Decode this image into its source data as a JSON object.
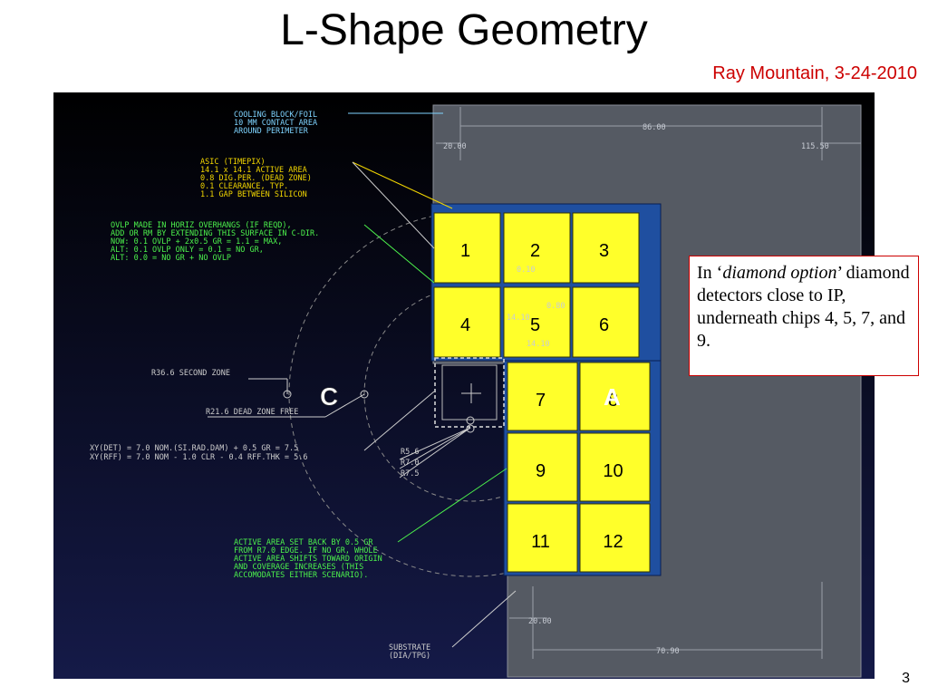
{
  "slide": {
    "title": "L-Shape Geometry",
    "subtitle": "Ray Mountain, 3-24-2010",
    "page_number": "3"
  },
  "callout": {
    "prefix": "In ‘",
    "emphasis": "diamond option",
    "suffix": "’ diamond detectors close to IP, underneath chips 4, 5, 7, and 9."
  },
  "chips": [
    "1",
    "2",
    "3",
    "4",
    "5",
    "6",
    "7",
    "8",
    "9",
    "10",
    "11",
    "12"
  ],
  "annotations": {
    "cooling": [
      "COOLING BLOCK/FOIL",
      "10 MM CONTACT AREA",
      "AROUND PERIMETER"
    ],
    "asic": [
      "ASIC (TIMEPIX)",
      "14.1 x 14.1 ACTIVE AREA",
      "0.8 DIG.PER. (DEAD ZONE)",
      "0.1 CLEARANCE, TYP.",
      "1.1 GAP BETWEEN SILICON"
    ],
    "ovlp": [
      "OVLP MADE IN HORIZ OVERHANGS (IF REQD),",
      "ADD OR RM BY EXTENDING THIS SURFACE IN C-DIR.",
      "NOW: 0.1 OVLP + 2x0.5 GR = 1.1 = MAX,",
      "ALT: 0.1 OVLP ONLY = 0.1 = NO GR,",
      "ALT: 0.0 = NO GR + NO OVLP"
    ],
    "second_zone": "R36.6 SECOND ZONE",
    "dead_zone": "R21.6 DEAD ZONE FREE",
    "xy": [
      "XY(DET) = 7.0 NOM.(SI.RAD.DAM) + 0.5 GR    = 7.5",
      "XY(RFF) = 7.0 NOM - 1.0 CLR - 0.4 RFF.THK = 5.6"
    ],
    "radii": [
      "R5.6",
      "R7.0",
      "R7.5"
    ],
    "active_area": [
      "ACTIVE AREA SET BACK BY 0.5 GR",
      "FROM R7.0 EDGE.  IF NO GR, WHOLE",
      "ACTIVE AREA SHIFTS TOWARD ORIGIN",
      "AND COVERAGE INCREASES (THIS",
      "ACCOMODATES EITHER SCENARIO)."
    ],
    "substrate": [
      "SUBSTRATE",
      "(DIA/TPG)"
    ],
    "c_label": "C",
    "a_label": "A"
  },
  "dimensions": {
    "d86": "86.00",
    "d20_top": "20.00",
    "d115": "115.50",
    "d010": "0.10",
    "d080": "0.80",
    "d1410_v": "14.10",
    "d1410_h": "14.10",
    "d20_bottom": "20.00",
    "d7090": "70.90"
  },
  "colors": {
    "cad_text": "#7fd4ff",
    "asic_text": "#f2d600",
    "ovlp_text": "#4cf24c",
    "chip_fill": "#ffff2a",
    "substrate": "#555a63",
    "callout_border": "#cc0000"
  }
}
